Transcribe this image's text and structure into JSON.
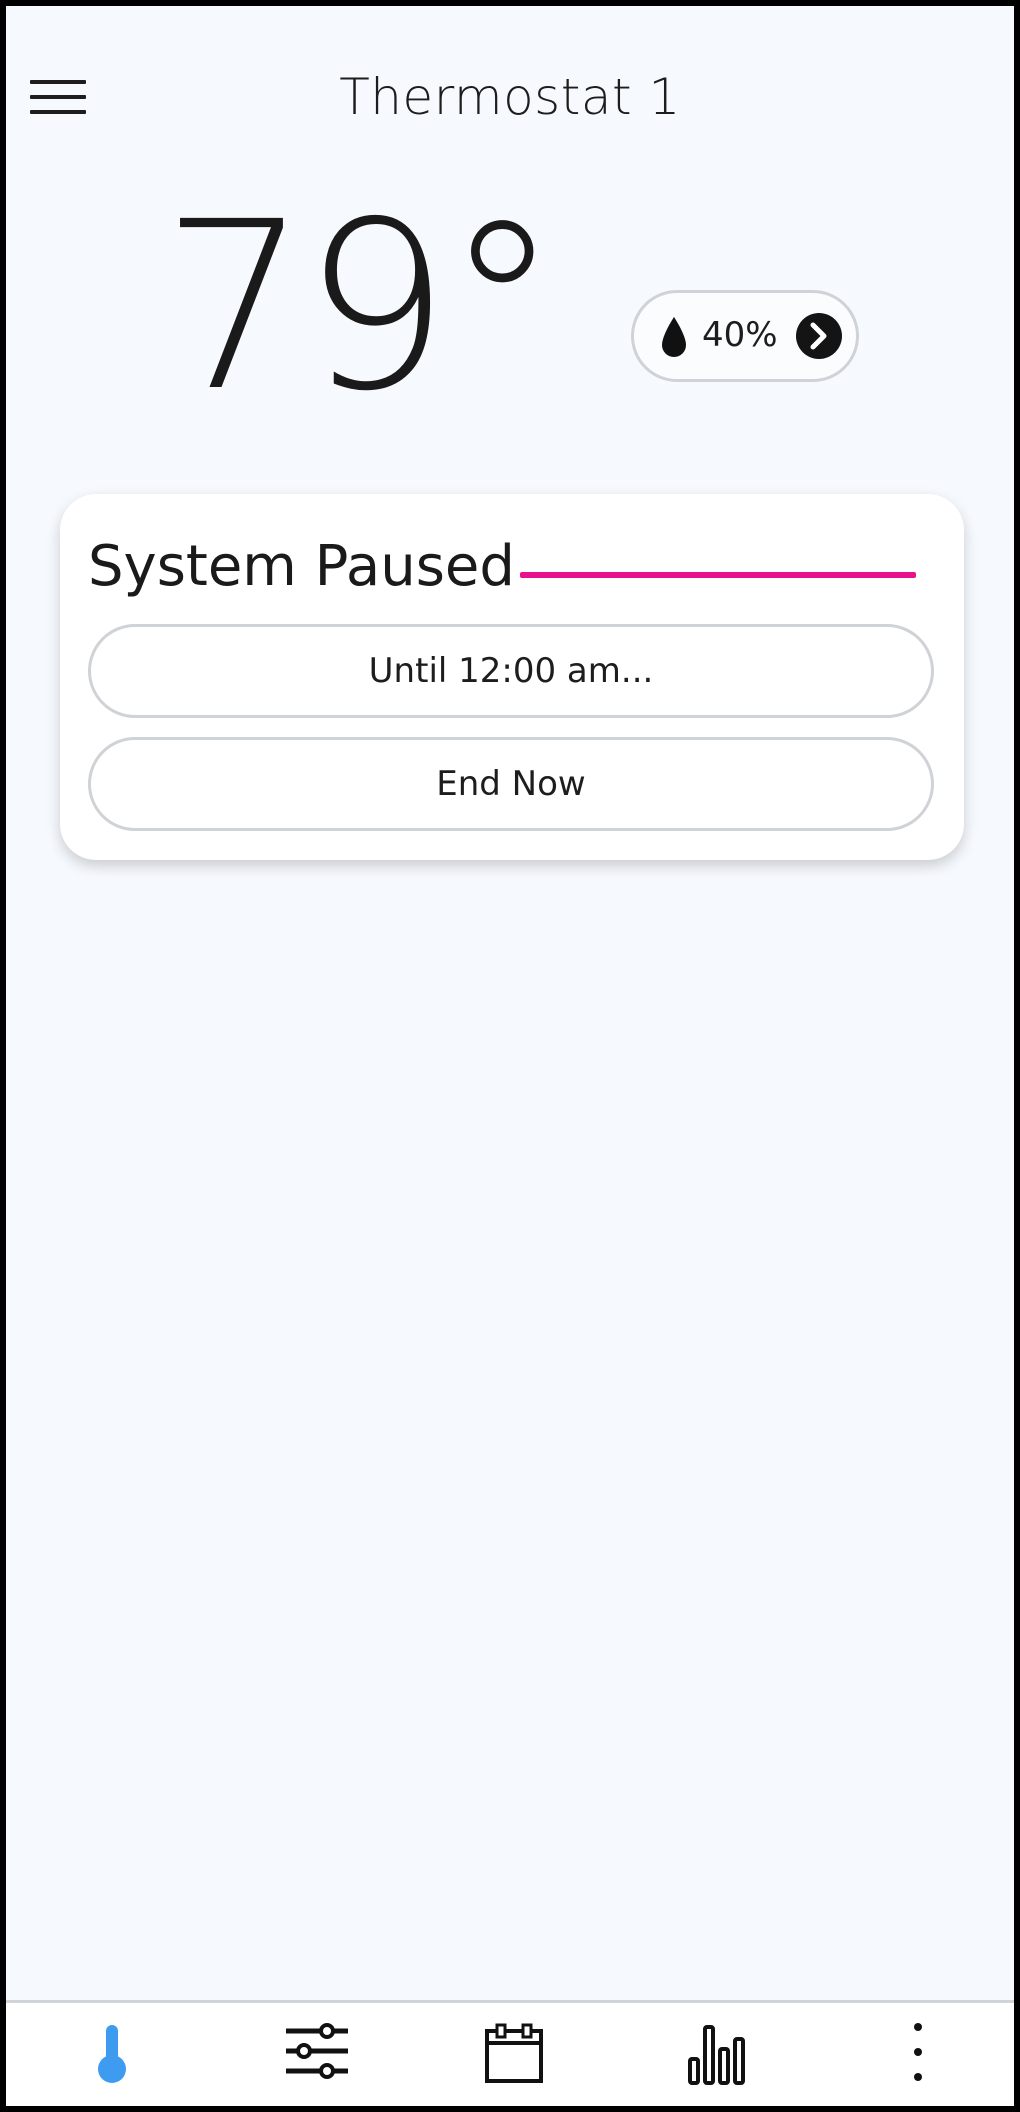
{
  "header": {
    "title": "Thermostat 1",
    "menu_icon": "hamburger-menu-icon"
  },
  "current": {
    "temperature": "79°",
    "humidity": "40%",
    "humidity_icon": "water-drop-icon",
    "humidity_chevron_icon": "chevron-right-circle-icon"
  },
  "status_card": {
    "title": "System Paused",
    "accent_color": "#e8128d",
    "until_label": "Until 12:00 am...",
    "end_label": "End Now"
  },
  "bottom_nav": {
    "items": [
      {
        "icon": "thermometer-icon",
        "active": true,
        "color": "#3d9bf0"
      },
      {
        "icon": "sliders-icon",
        "active": false
      },
      {
        "icon": "calendar-icon",
        "active": false
      },
      {
        "icon": "bar-chart-icon",
        "active": false
      },
      {
        "icon": "more-vertical-icon",
        "active": false
      }
    ]
  }
}
